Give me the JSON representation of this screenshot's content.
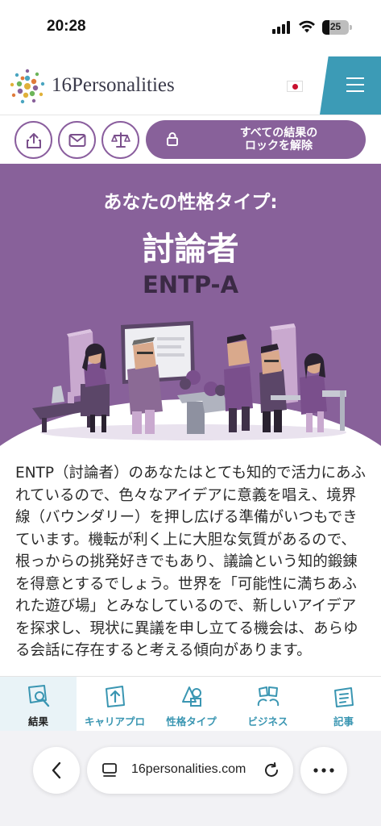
{
  "status_bar": {
    "time": "20:28",
    "battery": "25"
  },
  "header": {
    "brand": "16Personalities",
    "language": "ja"
  },
  "actions": {
    "unlock_line1": "すべての結果の",
    "unlock_line2": "ロックを解除"
  },
  "hero": {
    "subtitle": "あなたの性格タイプ:",
    "title": "討論者",
    "code": "ENTP-A"
  },
  "description": "ENTP（討論者）のあなたはとても知的で活力にあふれているので、色々なアイデアに意義を唱え、境界線（バウンダリー）を押し広げる準備がいつもできています。機転が利く上に大胆な気質があるので、根っからの挑発好きでもあり、議論という知的鍛錬を得意とするでしょう。世界を「可能性に満ちあふれた遊び場」とみなしているので、新しいアイデアを探求し、現状に異議を申し立てる機会は、あらゆる会話に存在すると考える傾向があります。",
  "bottom_nav": [
    {
      "label": "結果",
      "icon": "results-icon"
    },
    {
      "label": "キャリアプロ",
      "icon": "career-icon"
    },
    {
      "label": "性格タイプ",
      "icon": "types-icon"
    },
    {
      "label": "ビジネス",
      "icon": "business-icon"
    },
    {
      "label": "記事",
      "icon": "articles-icon"
    }
  ],
  "browser": {
    "url": "16personalities.com"
  },
  "colors": {
    "accent_purple": "#88619a",
    "teal": "#3c9bb6"
  }
}
